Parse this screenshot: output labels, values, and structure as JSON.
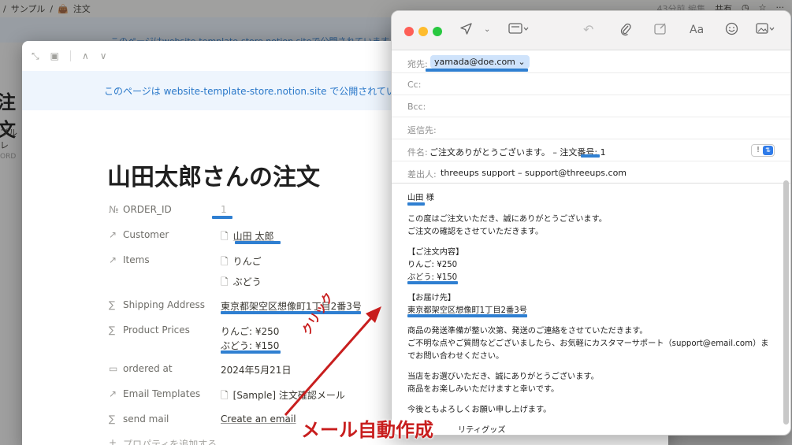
{
  "background": {
    "breadcrumbs": [
      "/",
      "サンプル",
      "/",
      "👜",
      "注文"
    ],
    "top_right": [
      "43分前 編集",
      "共有",
      "◷",
      "☆",
      "···"
    ],
    "banner_text": "このページはwebsite-template-store.notion.siteで公開されています",
    "left_title": "注文",
    "left_sub": "プルレ",
    "left_col": "ORD"
  },
  "notion": {
    "toolbar": [
      "⤡",
      "▣",
      "∧",
      "∨"
    ],
    "banner": "このページは website-template-store.notion.site で公開されていま",
    "title": "山田太郎さんの注文",
    "properties": [
      {
        "icon": "№",
        "label": "ORDER_ID",
        "value": "1"
      },
      {
        "icon": "↗",
        "label": "Customer",
        "value": "山田 太郎"
      },
      {
        "icon": "↗",
        "label": "Items",
        "value": "りんご"
      },
      {
        "icon": "",
        "label": "",
        "value": "ぶどう"
      },
      {
        "icon": "∑",
        "label": "Shipping Address",
        "value": "東京都架空区想像町1丁目2番3号"
      },
      {
        "icon": "∑",
        "label": "Product Prices",
        "value": "りんご: ¥250"
      },
      {
        "icon": "",
        "label": "",
        "value": "ぶどう: ¥150"
      },
      {
        "icon": "▭",
        "label": "ordered at",
        "value": "2024年5月21日"
      },
      {
        "icon": "↗",
        "label": "Email Templates",
        "value": "[Sample] 注文確認メール"
      },
      {
        "icon": "∑",
        "label": "send mail",
        "value": "Create an email"
      },
      {
        "icon": "+",
        "label": "プロパティを追加する",
        "value": ""
      }
    ]
  },
  "mail": {
    "toolbar_icons": [
      "paper-plane",
      "chevron-down",
      "header-fields",
      "undo-arrow",
      "paperclip",
      "attachment-box",
      "Aa",
      "emoji",
      "photo"
    ],
    "to_label": "宛先:",
    "to_value": "yamada@doe.com",
    "cc_label": "Cc:",
    "bcc_label": "Bcc:",
    "reply_label": "返信先:",
    "subject_label": "件名:",
    "subject_value": "ご注文ありがとうございます。 – 注文番号: 1",
    "from_label": "差出人:",
    "from_value": "threeups support – support@threeups.com",
    "body": [
      "山田 様",
      "",
      "この度はご注文いただき、誠にありがとうございます。",
      "ご注文の確認をさせていただきます。",
      "",
      "【ご注文内容】",
      "りんご: ¥250",
      "ぶどう: ¥150",
      "",
      "【お届け先】",
      "東京都架空区想像町1丁目2番3号",
      "",
      "商品の発送準備が整い次第、発送のご連絡をさせていただきます。",
      "ご不明な点やご質問などございましたら、お気軽にカスタマーサポート（support@email.com）ま",
      "でお問い合わせください。",
      "",
      "当店をお選びいただき、誠にありがとうございます。",
      "商品をお楽しみいただけますと幸いです。",
      "",
      "今後ともよろしくお願い申し上げます。",
      "",
      "リティグッズ"
    ]
  },
  "annotations": {
    "click": "クリック",
    "auto_mail": "メール自動作成",
    "color": "#c81e1e",
    "underline_color": "#2f7fd1"
  }
}
